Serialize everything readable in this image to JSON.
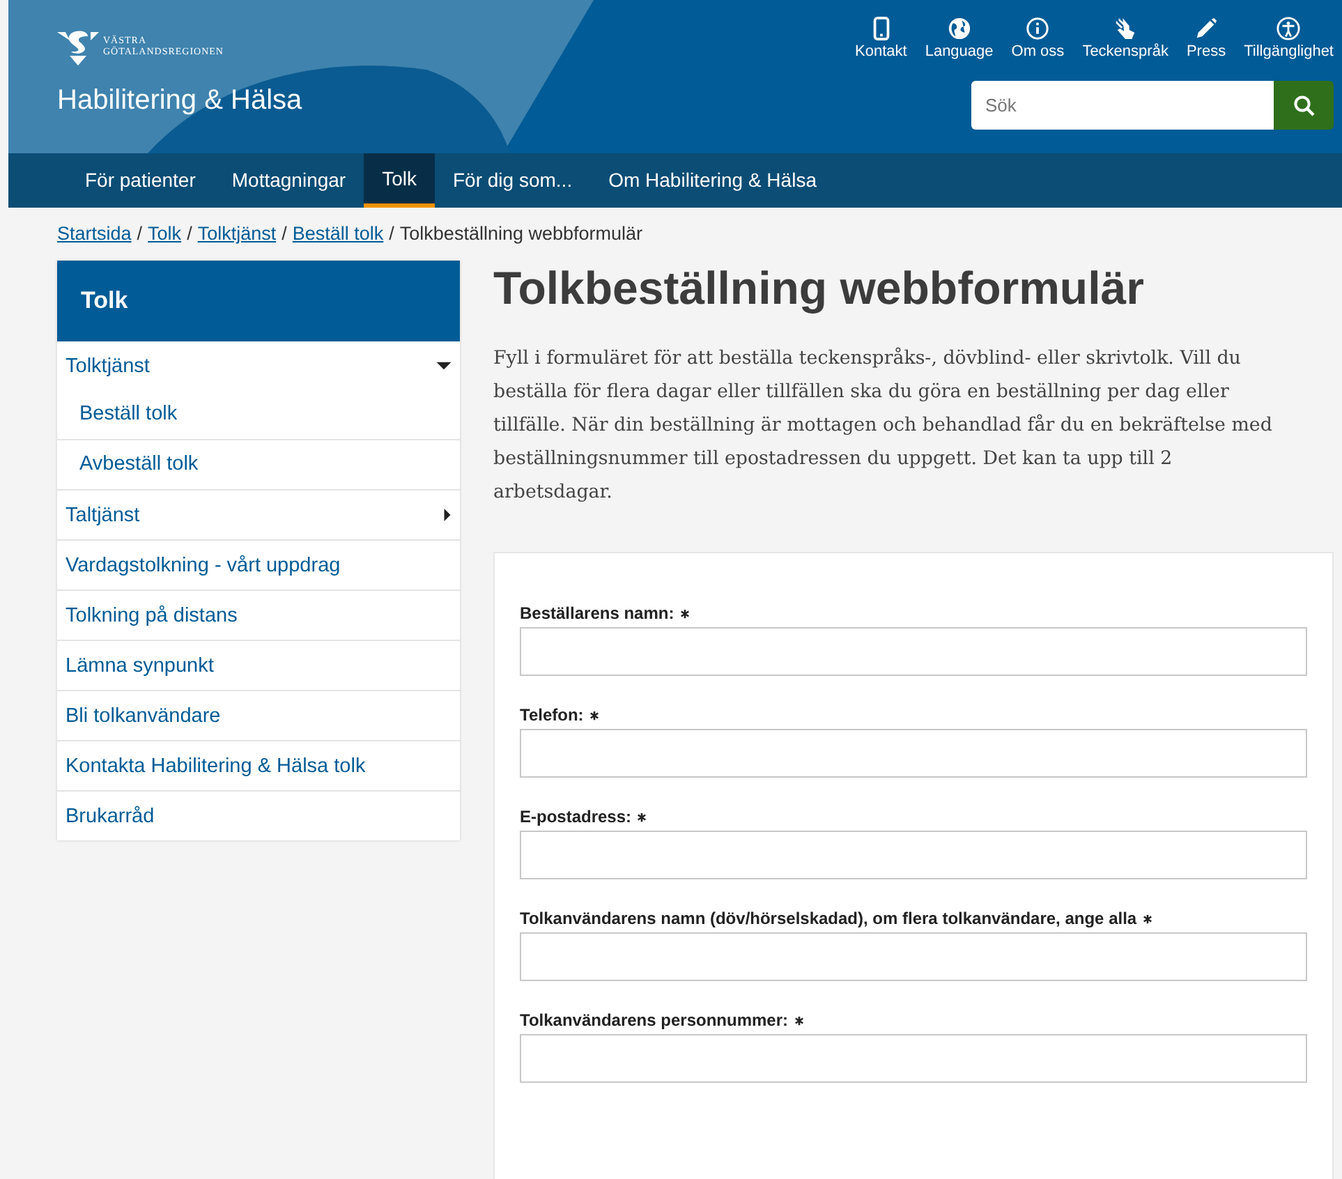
{
  "header": {
    "logo_text": [
      "VÄSTRA",
      "GÖTALANDSREGIONEN"
    ],
    "site_title": "Habilitering & Hälsa",
    "top_links": [
      {
        "kind": "phone",
        "label": "Kontakt"
      },
      {
        "kind": "globe",
        "label": "Language"
      },
      {
        "kind": "info",
        "label": "Om oss"
      },
      {
        "kind": "hands",
        "label": "Teckenspråk"
      },
      {
        "kind": "pencil",
        "label": "Press"
      },
      {
        "kind": "accessibility",
        "label": "Tillgänglighet"
      }
    ],
    "search": {
      "placeholder": "Sök"
    }
  },
  "nav": [
    {
      "label": "För patienter",
      "selected": false
    },
    {
      "label": "Mottagningar",
      "selected": false
    },
    {
      "label": "Tolk",
      "selected": true
    },
    {
      "label": "För dig som...",
      "selected": false
    },
    {
      "label": "Om Habilitering & Hälsa",
      "selected": false
    }
  ],
  "breadcrumb": {
    "separator": "/",
    "links": [
      "Startsida",
      "Tolk",
      "Tolktjänst",
      "Beställ tolk"
    ],
    "current": "Tolkbeställning webbformulär"
  },
  "sidebar": {
    "title": "Tolk",
    "items": [
      {
        "label": "Tolktjänst",
        "kind": "group",
        "expanded": true,
        "children": [
          {
            "label": "Beställ tolk"
          },
          {
            "label": "Avbeställ tolk"
          }
        ]
      },
      {
        "label": "Taltjänst",
        "kind": "group",
        "expanded": false
      },
      {
        "label": "Vardagstolkning - vårt uppdrag",
        "kind": "link"
      },
      {
        "label": "Tolkning på distans",
        "kind": "link"
      },
      {
        "label": "Lämna synpunkt",
        "kind": "link"
      },
      {
        "label": "Bli tolkanvändare",
        "kind": "link"
      },
      {
        "label": "Kontakta Habilitering & Hälsa tolk",
        "kind": "link"
      },
      {
        "label": "Brukarråd",
        "kind": "link"
      }
    ]
  },
  "page": {
    "title": "Tolkbeställning webbformulär",
    "intro": "Fyll i formuläret för att beställa teckenspråks-, dövblind- eller skrivtolk. Vill du beställa för flera dagar eller tillfällen ska du göra en beställning per dag eller tillfälle. När din beställning är mottagen och behandlad får du en bekräftelse med beställningsnummer till epostadressen du uppgett. Det kan ta upp till 2 arbetsdagar."
  },
  "form": {
    "fields": [
      {
        "label": "Beställarens namn:",
        "required": true
      },
      {
        "label": "Telefon:",
        "required": true
      },
      {
        "label": "E-postadress:",
        "required": true
      },
      {
        "label": "Tolkanvändarens namn (döv/hörselskadad), om flera tolkanvändare, ange alla",
        "required": true
      },
      {
        "label": "Tolkanvändarens personnummer:",
        "required": true
      }
    ]
  }
}
